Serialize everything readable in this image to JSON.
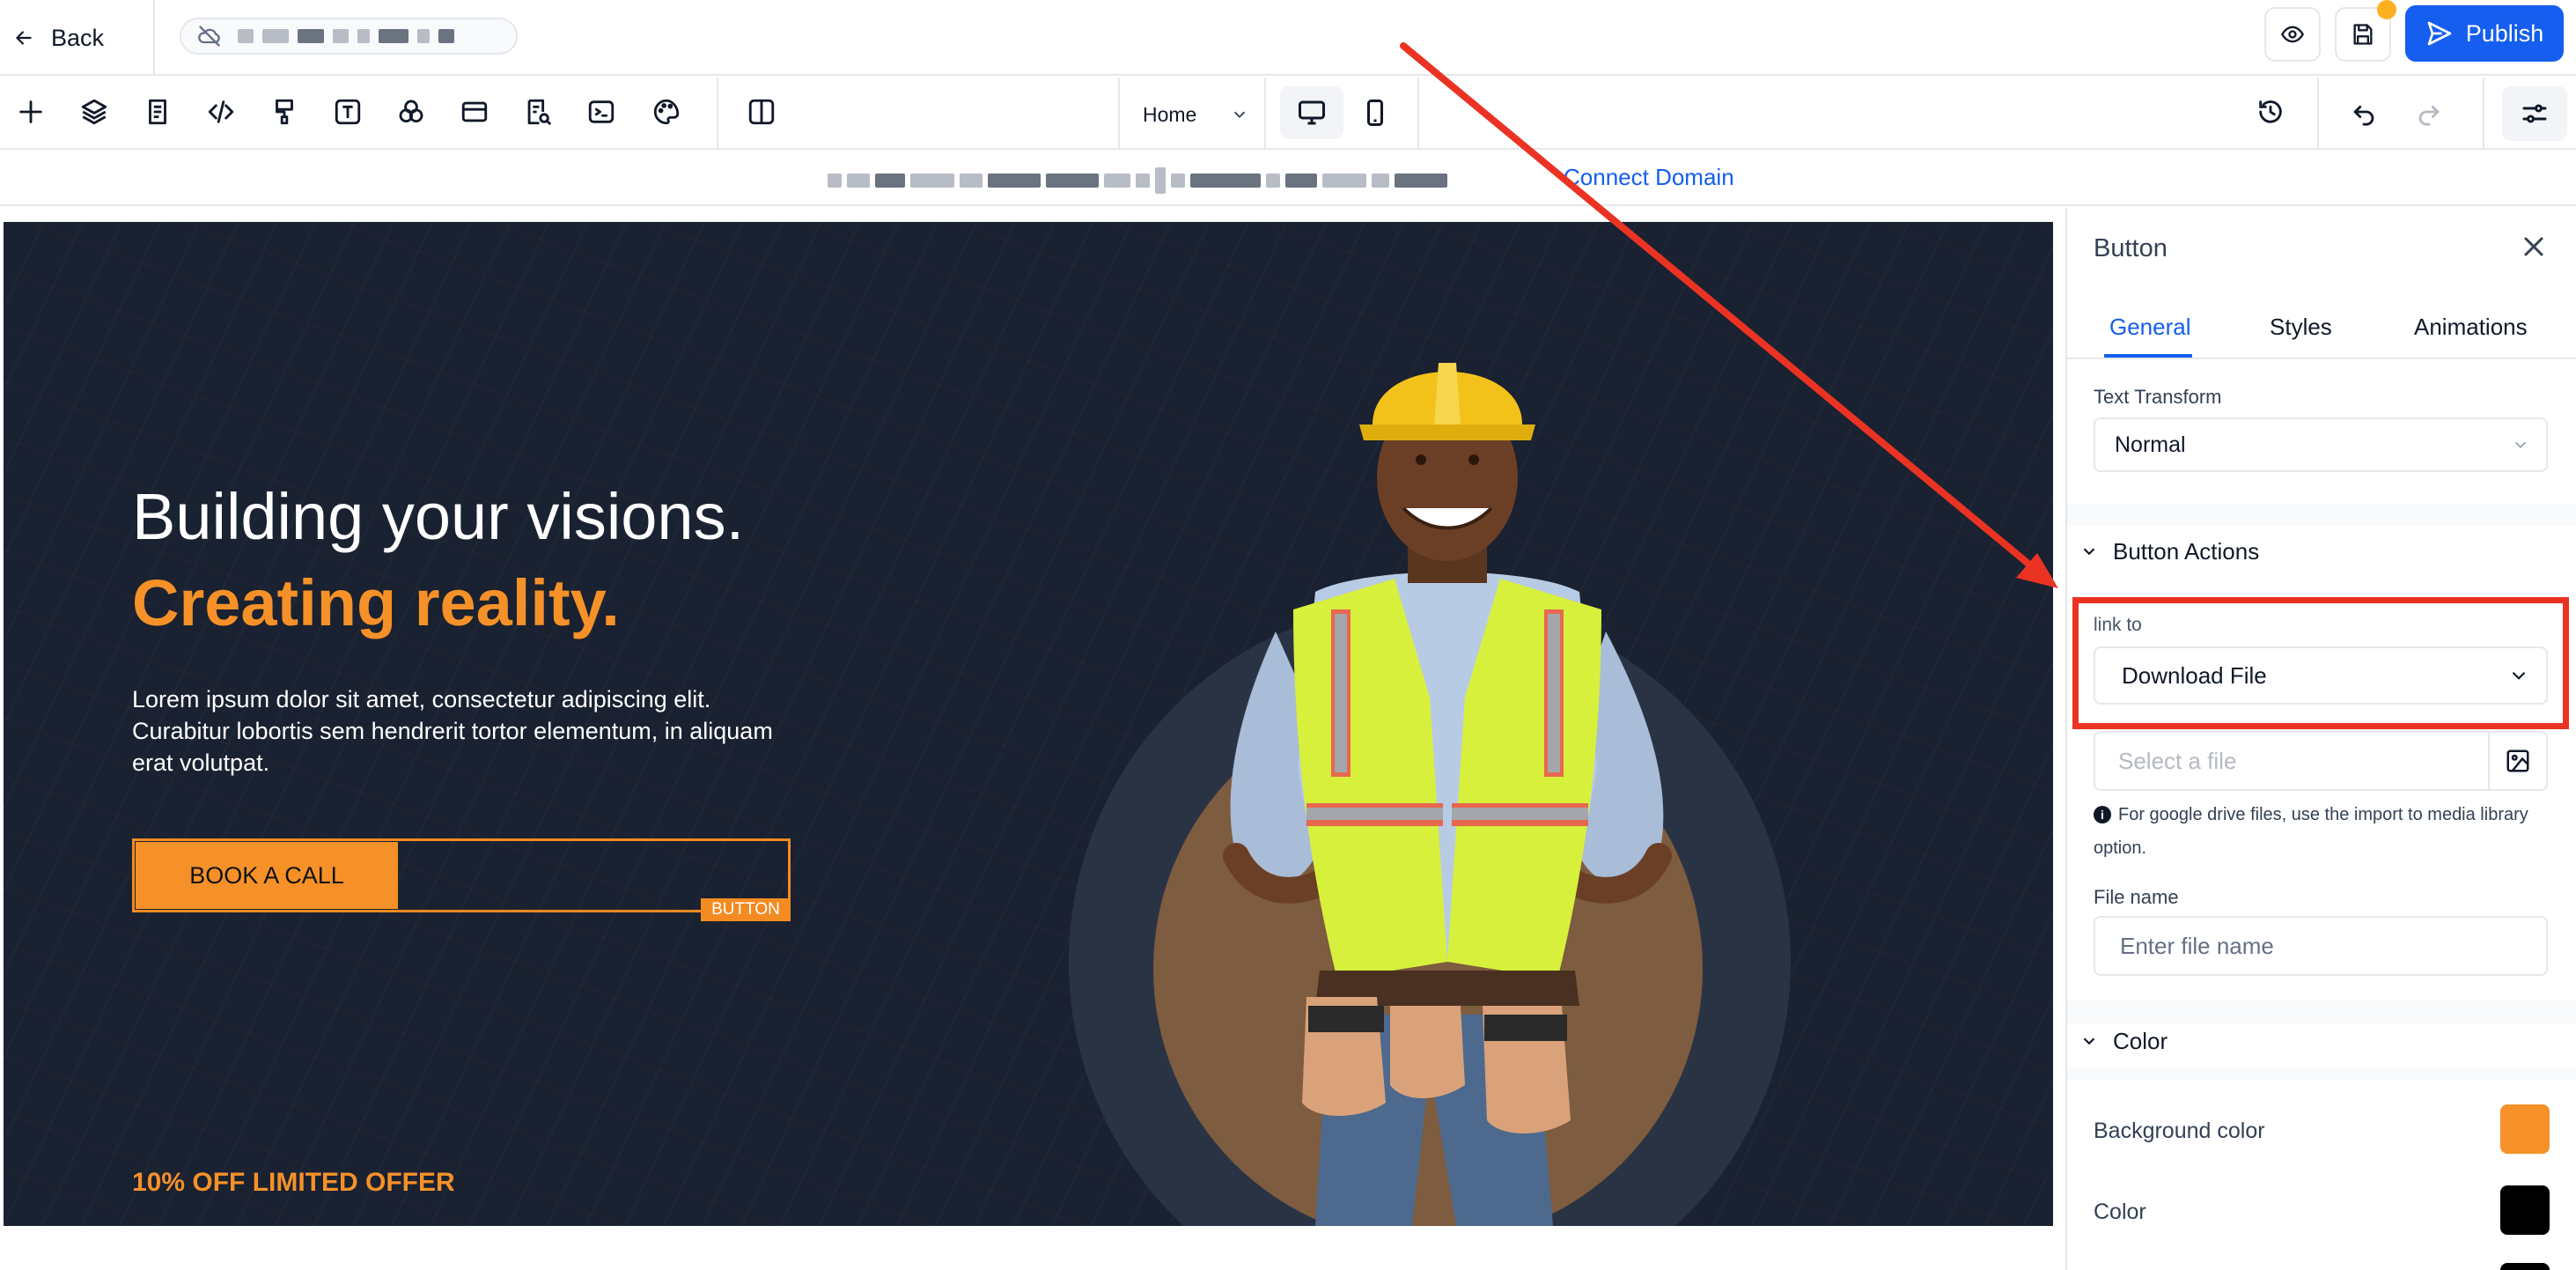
{
  "topbar": {
    "back_label": "Back",
    "publish_label": "Publish"
  },
  "toolbar": {
    "page_selector": "Home",
    "tools": [
      "add-icon",
      "layers-icon",
      "pages-icon",
      "code-icon",
      "paint-brush-icon",
      "text-icon",
      "shapes-icon",
      "section-icon",
      "seo-icon",
      "terminal-icon",
      "palette-icon",
      "split-view-icon"
    ]
  },
  "urlbar": {
    "connect_domain": "Connect Domain"
  },
  "hero": {
    "title_line1": "Building your visions.",
    "title_line2": "Creating reality.",
    "description": "Lorem ipsum dolor sit amet, consectetur adipiscing elit. Curabitur lobortis sem hendrerit tortor elementum, in aliquam erat volutpat.",
    "cta_label": "BOOK A CALL",
    "selected_tag": "BUTTON",
    "offer": "10% OFF LIMITED OFFER"
  },
  "panel": {
    "title": "Button",
    "tabs": [
      {
        "label": "General",
        "active": true
      },
      {
        "label": "Styles",
        "active": false
      },
      {
        "label": "Animations",
        "active": false
      }
    ],
    "text_transform": {
      "label": "Text Transform",
      "value": "Normal"
    },
    "button_actions": {
      "heading": "Button Actions",
      "link_to_label": "link to",
      "link_to_value": "Download File",
      "file_placeholder": "Select a file",
      "gdrive_note": "For google drive files, use the import to media library option.",
      "file_name_label": "File name",
      "file_name_placeholder": "Enter file name"
    },
    "color": {
      "heading": "Color",
      "background_label": "Background color",
      "background_value": "#f59128",
      "color_label": "Color",
      "color_value": "#000000"
    }
  },
  "colors": {
    "accent": "#155eef",
    "brand_orange": "#f59128",
    "highlight_red": "#ea3323"
  }
}
